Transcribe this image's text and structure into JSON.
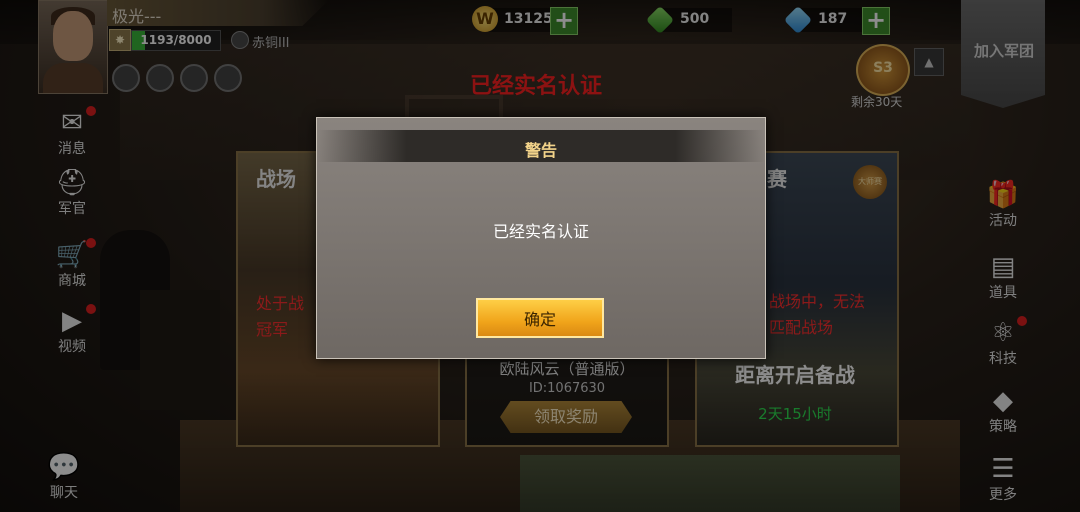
{
  "player": {
    "name": "极光---",
    "rank_icon": "rank-star-icon",
    "xp": "1193/8000",
    "xp_fraction": 0.149,
    "tier": "赤铜III"
  },
  "resources": {
    "gold": "131250",
    "gems": "500",
    "diamonds": "187"
  },
  "top_right": {
    "join_legion": "加入军团",
    "vip_label": "S3",
    "vip_days": "剩余30天",
    "collapse_icon": "chevron-up-icon"
  },
  "headline": "已经实名认证",
  "left_menu": [
    {
      "label": "消息",
      "icon": "envelope-icon",
      "dot": true
    },
    {
      "label": "军官",
      "icon": "officer-icon",
      "dot": false
    },
    {
      "label": "商城",
      "icon": "cart-icon",
      "dot": true
    },
    {
      "label": "视频",
      "icon": "video-icon",
      "dot": true
    },
    {
      "label": "聊天",
      "icon": "chat-icon",
      "dot": false
    }
  ],
  "right_menu": [
    {
      "label": "活动",
      "icon": "gift-icon",
      "dot": false
    },
    {
      "label": "道具",
      "icon": "items-icon",
      "dot": false
    },
    {
      "label": "科技",
      "icon": "atom-icon",
      "dot": true
    },
    {
      "label": "策略",
      "icon": "cards-icon",
      "dot": false
    },
    {
      "label": "更多",
      "icon": "menu-icon",
      "dot": false
    }
  ],
  "cards": {
    "battle": {
      "title": "战场",
      "note": "处于战\n冠军"
    },
    "server": {
      "name": "欧陆风云（普通版）",
      "id": "ID:1067630",
      "claim": "领取奖励"
    },
    "match": {
      "title": "赛",
      "note_line1": "战场中，无法",
      "note_line2": "匹配战场",
      "countdown_title": "距离开启备战",
      "countdown": "2天15小时",
      "badge": "大师赛"
    }
  },
  "dialog": {
    "title": "警告",
    "message": "已经实名认证",
    "confirm": "确定"
  },
  "colors": {
    "headline": "#ff2222",
    "dialog_title": "#f2d38a",
    "confirm_button": "#f0a41a",
    "countdown": "#2ee051"
  }
}
